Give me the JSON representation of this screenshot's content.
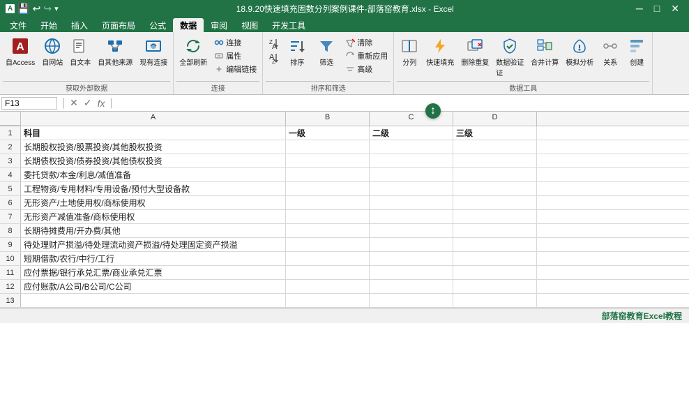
{
  "titleBar": {
    "title": "18.9.20快速填充固数分列案例课件-部落窑教育.xlsx - Excel",
    "saveIcon": "💾",
    "undoIcon": "↩",
    "redoIcon": "↪"
  },
  "ribbonTabs": {
    "tabs": [
      "文件",
      "开始",
      "插入",
      "页面布局",
      "公式",
      "数据",
      "审阅",
      "视图",
      "开发工具"
    ],
    "activeTab": "数据"
  },
  "ribbonGroups": {
    "getExternalData": {
      "label": "获取外部数据",
      "buttons": [
        "自Access",
        "自网站",
        "自文本",
        "自其他来源",
        "现有连接",
        "全部刷新"
      ]
    },
    "connections": {
      "label": "连接",
      "buttons": [
        "连接",
        "属性",
        "编辑链接"
      ]
    },
    "sortFilter": {
      "label": "排序和筛选",
      "buttons": [
        "升序",
        "降序",
        "排序",
        "筛选",
        "清除",
        "重新应用",
        "高级"
      ]
    },
    "dataTools": {
      "label": "数据工具",
      "buttons": [
        "分列",
        "快速填充",
        "删除重复",
        "数据验证",
        "合并计算",
        "模拟分析",
        "关系",
        "创建"
      ]
    }
  },
  "formulaBar": {
    "cellRef": "F13",
    "cancelLabel": "×",
    "confirmLabel": "✓",
    "formula": ""
  },
  "columns": {
    "headers": [
      "",
      "A",
      "B",
      "C",
      "D"
    ],
    "widths": [
      30,
      380,
      120,
      120,
      120
    ],
    "labels": {
      "A": "A",
      "B": "B",
      "C": "C",
      "D": "D"
    }
  },
  "rows": [
    {
      "rowNum": 1,
      "cells": [
        "科目",
        "一级",
        "二级",
        "三级"
      ]
    },
    {
      "rowNum": 2,
      "cells": [
        "长期股权投资/股票投资/其他股权投资",
        "",
        "",
        ""
      ]
    },
    {
      "rowNum": 3,
      "cells": [
        "长期债权投资/债券投资/其他债权投资",
        "",
        "",
        ""
      ]
    },
    {
      "rowNum": 4,
      "cells": [
        "委托贷款/本金/利息/减值准备",
        "",
        "",
        ""
      ]
    },
    {
      "rowNum": 5,
      "cells": [
        "工程物资/专用材料/专用设备/预付大型设备款",
        "",
        "",
        ""
      ]
    },
    {
      "rowNum": 6,
      "cells": [
        "无形资产/土地使用权/商标使用权",
        "",
        "",
        ""
      ]
    },
    {
      "rowNum": 7,
      "cells": [
        "无形资产减值准备/商标使用权",
        "",
        "",
        ""
      ]
    },
    {
      "rowNum": 8,
      "cells": [
        "长期待摊费用/开办费/其他",
        "",
        "",
        ""
      ]
    },
    {
      "rowNum": 9,
      "cells": [
        "待处理财产损溢/待处理流动资产损溢/待处理固定资产损溢",
        "",
        "",
        ""
      ]
    },
    {
      "rowNum": 10,
      "cells": [
        "短期借款/农行/中行/工行",
        "",
        "",
        ""
      ]
    },
    {
      "rowNum": 11,
      "cells": [
        "应付票据/银行承兑汇票/商业承兑汇票",
        "",
        "",
        ""
      ]
    },
    {
      "rowNum": 12,
      "cells": [
        "应付账款/A公司/B公司/C公司",
        "",
        "",
        ""
      ]
    },
    {
      "rowNum": 13,
      "cells": [
        "",
        "",
        "",
        ""
      ]
    }
  ],
  "statusBar": {
    "brand": "部落窑教育Excel教程"
  }
}
